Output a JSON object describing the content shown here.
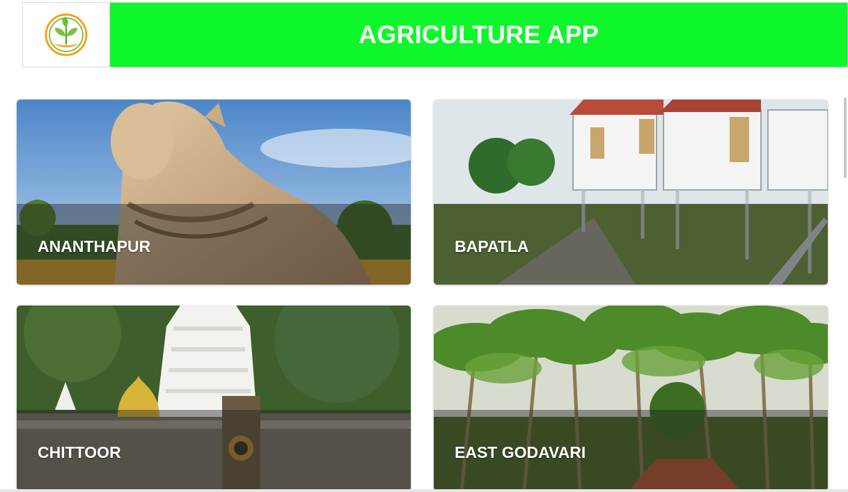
{
  "header": {
    "title": "AGRICULTURE APP",
    "logo_icon": "sprout-leaf-logo-icon",
    "background_color": "#0ef72a"
  },
  "districts": [
    {
      "label": "ANANTHAPUR",
      "image": "nandi-statue-image"
    },
    {
      "label": "BAPATLA",
      "image": "cottages-on-stilts-image"
    },
    {
      "label": "CHITTOOR",
      "image": "temple-gopuram-image"
    },
    {
      "label": "EAST GODAVARI",
      "image": "coconut-palms-image"
    }
  ]
}
